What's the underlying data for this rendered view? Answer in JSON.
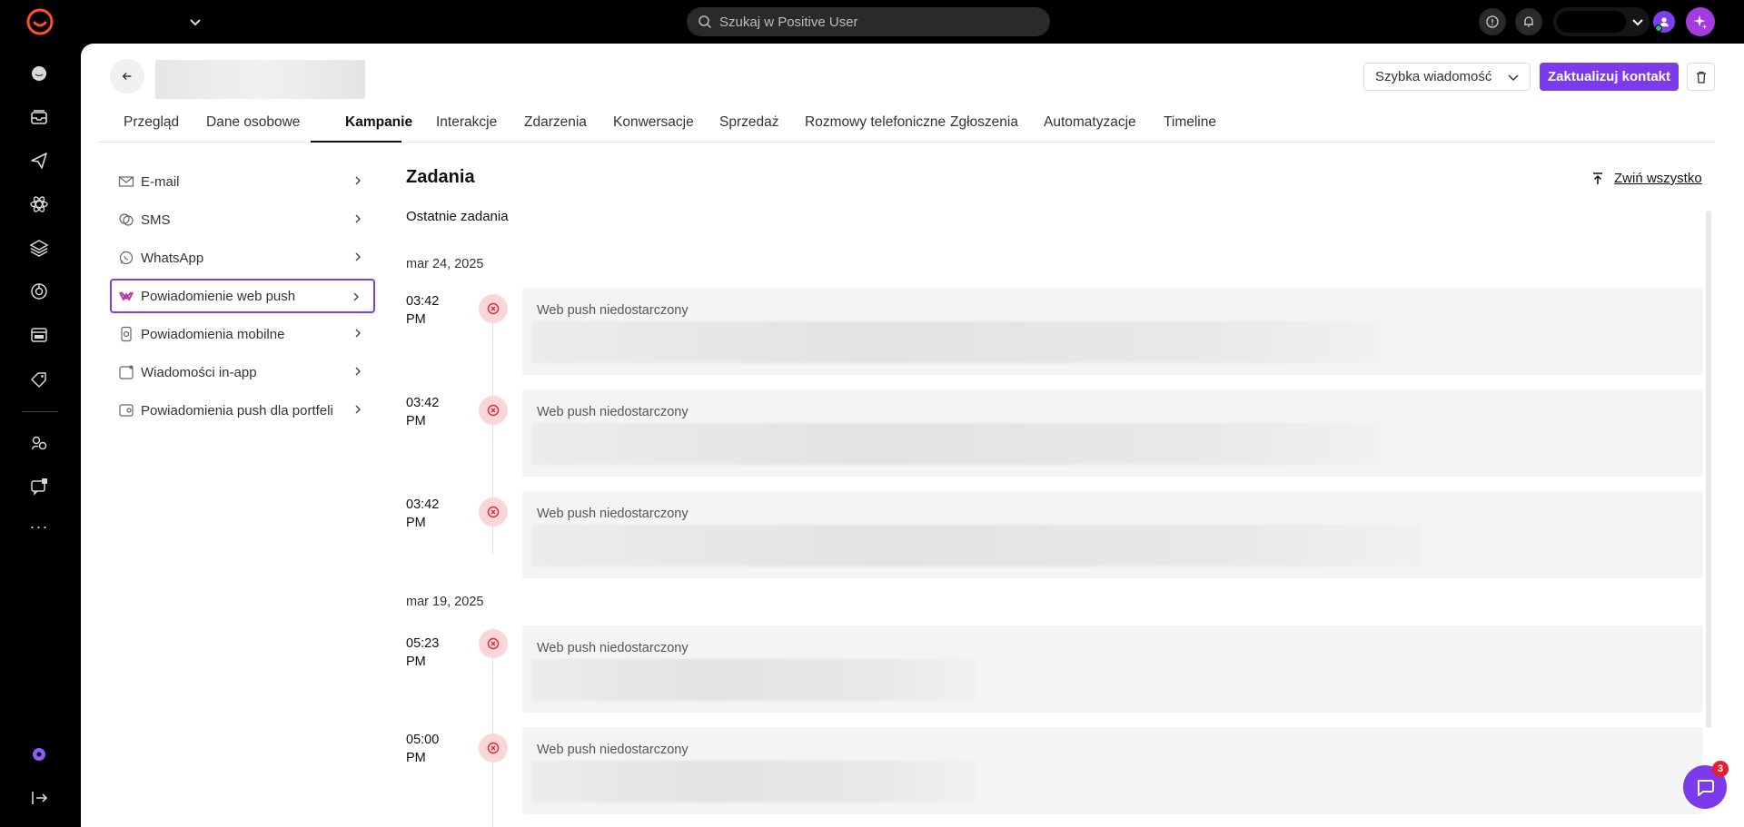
{
  "topbar": {
    "search_placeholder": "Szukaj w Positive User",
    "chat_badge_count": "3"
  },
  "contact": {
    "quick_message_label": "Szybka wiadomość",
    "update_button_label": "Zaktualizuj kontakt"
  },
  "tabs": [
    {
      "label": "Przegląd"
    },
    {
      "label": "Dane osobowe"
    },
    {
      "label": "Kampanie"
    },
    {
      "label": "Interakcje"
    },
    {
      "label": "Zdarzenia"
    },
    {
      "label": "Konwersacje"
    },
    {
      "label": "Sprzedaż"
    },
    {
      "label": "Rozmowy telefoniczne"
    },
    {
      "label": "Zgłoszenia"
    },
    {
      "label": "Automatyzacje"
    },
    {
      "label": "Timeline"
    }
  ],
  "active_tab": "Kampanie",
  "channels": [
    {
      "label": "E-mail",
      "icon": "mail-icon"
    },
    {
      "label": "SMS",
      "icon": "sms-icon"
    },
    {
      "label": "WhatsApp",
      "icon": "whatsapp-icon"
    },
    {
      "label": "Powiadomienie web push",
      "icon": "web-push-icon"
    },
    {
      "label": "Powiadomienia mobilne",
      "icon": "mobile-push-icon"
    },
    {
      "label": "Wiadomości in-app",
      "icon": "in-app-icon"
    },
    {
      "label": "Powiadomienia push dla portfeli",
      "icon": "wallet-icon"
    }
  ],
  "active_channel": "Powiadomienie web push",
  "content": {
    "title": "Zadania",
    "collapse_all_label": "Zwiń wszystko",
    "subtitle": "Ostatnie zadania",
    "groups": [
      {
        "date": "mar 24, 2025",
        "items": [
          {
            "time": "03:42 PM",
            "status": "Web push niedostarczony"
          },
          {
            "time": "03:42 PM",
            "status": "Web push niedostarczony"
          },
          {
            "time": "03:42 PM",
            "status": "Web push niedostarczony"
          }
        ]
      },
      {
        "date": "mar 19, 2025",
        "items": [
          {
            "time": "05:23 PM",
            "status": "Web push niedostarczony"
          },
          {
            "time": "05:00 PM",
            "status": "Web push niedostarczony"
          }
        ]
      }
    ]
  },
  "colors": {
    "accent": "#7c3aed",
    "error_bg": "#fbd6d8",
    "error_fg": "#d62c3a"
  }
}
